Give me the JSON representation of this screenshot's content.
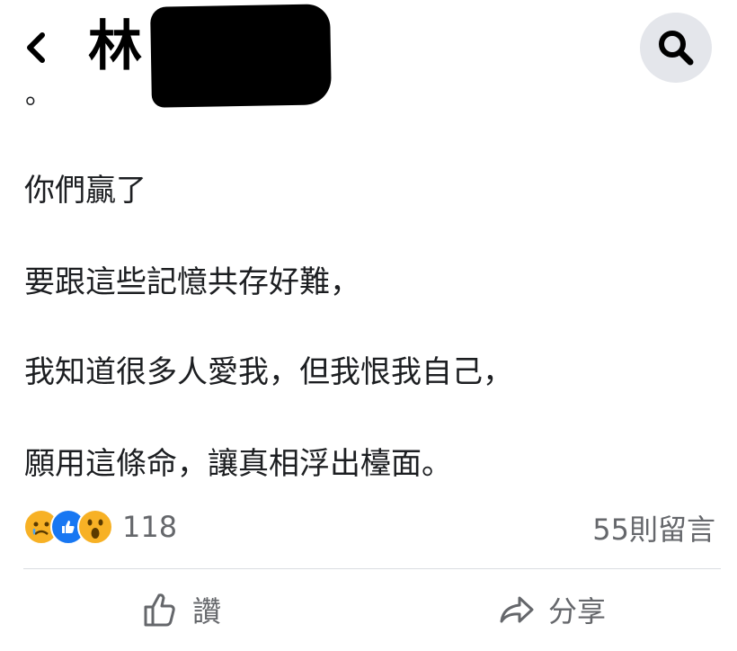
{
  "header": {
    "title": "林"
  },
  "post": {
    "leading_dot": "。",
    "lines": [
      "你們贏了",
      "要跟這些記憶共存好難，",
      "我知道很多人愛我，但我恨我自己，",
      "願用這條命，讓真相浮出檯面。"
    ]
  },
  "stats": {
    "reaction_count": "118",
    "comments": "55則留言"
  },
  "actions": {
    "like_label": "讚",
    "share_label": "分享"
  },
  "colors": {
    "secondary_text": "#65676b",
    "like_blue": "#1877f2",
    "reaction_yellow": "#f7b125",
    "search_bg": "#e4e6eb"
  }
}
